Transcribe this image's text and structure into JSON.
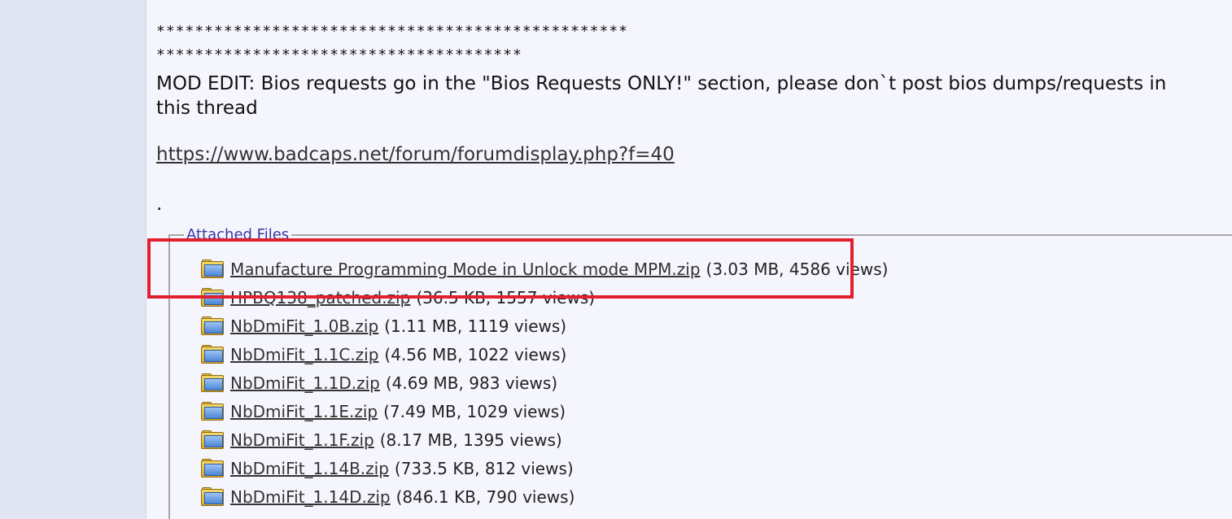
{
  "post": {
    "stars_line_1": "*************************************************",
    "stars_line_2": "**************************************",
    "mod_edit_line_1": "MOD EDIT: Bios requests go in the \"Bios Requests ONLY!\" section, please don`t post bios dumps/requests in",
    "mod_edit_line_2": "this thread",
    "forum_link": "https://www.badcaps.net/forum/forumdisplay.php?f=40",
    "dot": "."
  },
  "attachments": {
    "legend": "Attached Files",
    "files": [
      {
        "name": "Manufacture Programming Mode in Unlock mode MPM.zip",
        "meta": "(3.03 MB, 4586 views)",
        "icon": "zip-file-icon"
      },
      {
        "name": "HPBQ138_patched.zip",
        "meta": "(36.5 KB, 1557 views)",
        "icon": "zip-file-icon"
      },
      {
        "name": "NbDmiFit_1.0B.zip",
        "meta": "(1.11 MB, 1119 views)",
        "icon": "zip-file-icon"
      },
      {
        "name": "NbDmiFit_1.1C.zip",
        "meta": "(4.56 MB, 1022 views)",
        "icon": "zip-file-icon"
      },
      {
        "name": "NbDmiFit_1.1D.zip",
        "meta": "(4.69 MB, 983 views)",
        "icon": "zip-file-icon"
      },
      {
        "name": "NbDmiFit_1.1E.zip",
        "meta": "(7.49 MB, 1029 views)",
        "icon": "zip-file-icon"
      },
      {
        "name": "NbDmiFit_1.1F.zip",
        "meta": "(8.17 MB, 1395 views)",
        "icon": "zip-file-icon"
      },
      {
        "name": "NbDmiFit_1.14B.zip",
        "meta": "(733.5 KB, 812 views)",
        "icon": "zip-file-icon"
      },
      {
        "name": "NbDmiFit_1.14D.zip",
        "meta": "(846.1 KB, 790 views)",
        "icon": "zip-file-icon"
      }
    ]
  },
  "colors": {
    "highlight": "#e0202d",
    "legend": "#3535a8",
    "background": "#f5f5fd"
  }
}
